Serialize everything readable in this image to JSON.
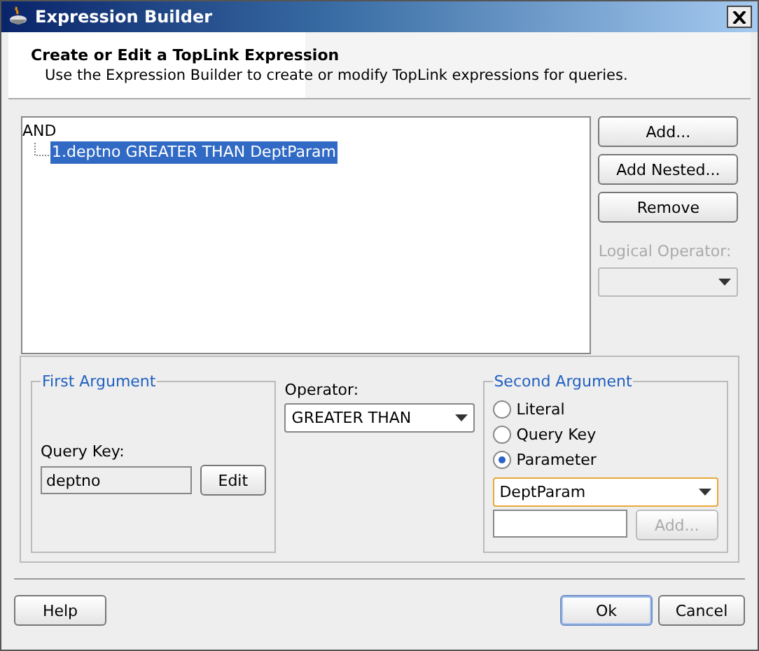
{
  "window": {
    "title": "Expression Builder"
  },
  "header": {
    "title": "Create or Edit a TopLink Expression",
    "subtitle": "Use the Expression Builder to create or modify TopLink expressions for queries."
  },
  "tree": {
    "label": "AND",
    "children": [
      {
        "label": "1.deptno GREATER THAN DeptParam",
        "selected": true
      }
    ]
  },
  "side_buttons": [
    {
      "label": "Add...",
      "disabled": false
    },
    {
      "label": "Add Nested...",
      "disabled": false
    },
    {
      "label": "Remove",
      "disabled": false
    }
  ],
  "logical_operator": {
    "label": "Logical Operator:",
    "disabled": true
  },
  "first_argument": {
    "title": "First Argument",
    "query_key_label": "Query Key:",
    "query_key_value": "deptno",
    "edit_button": "Edit"
  },
  "operator": {
    "label": "Operator:",
    "value": "GREATER THAN"
  },
  "second_argument": {
    "title": "Second Argument",
    "options": [
      {
        "label": "Literal",
        "selected": false
      },
      {
        "label": "Query Key",
        "selected": false
      },
      {
        "label": "Parameter",
        "selected": true
      }
    ],
    "parameter": "DeptParam",
    "add_button": {
      "label": "Add...",
      "disabled": true
    }
  },
  "footer_left_buttons": [
    {
      "label": "Help",
      "default": false
    }
  ],
  "footer_right_buttons": [
    {
      "label": "Ok",
      "default": true
    },
    {
      "label": "Cancel",
      "default": false
    }
  ]
}
